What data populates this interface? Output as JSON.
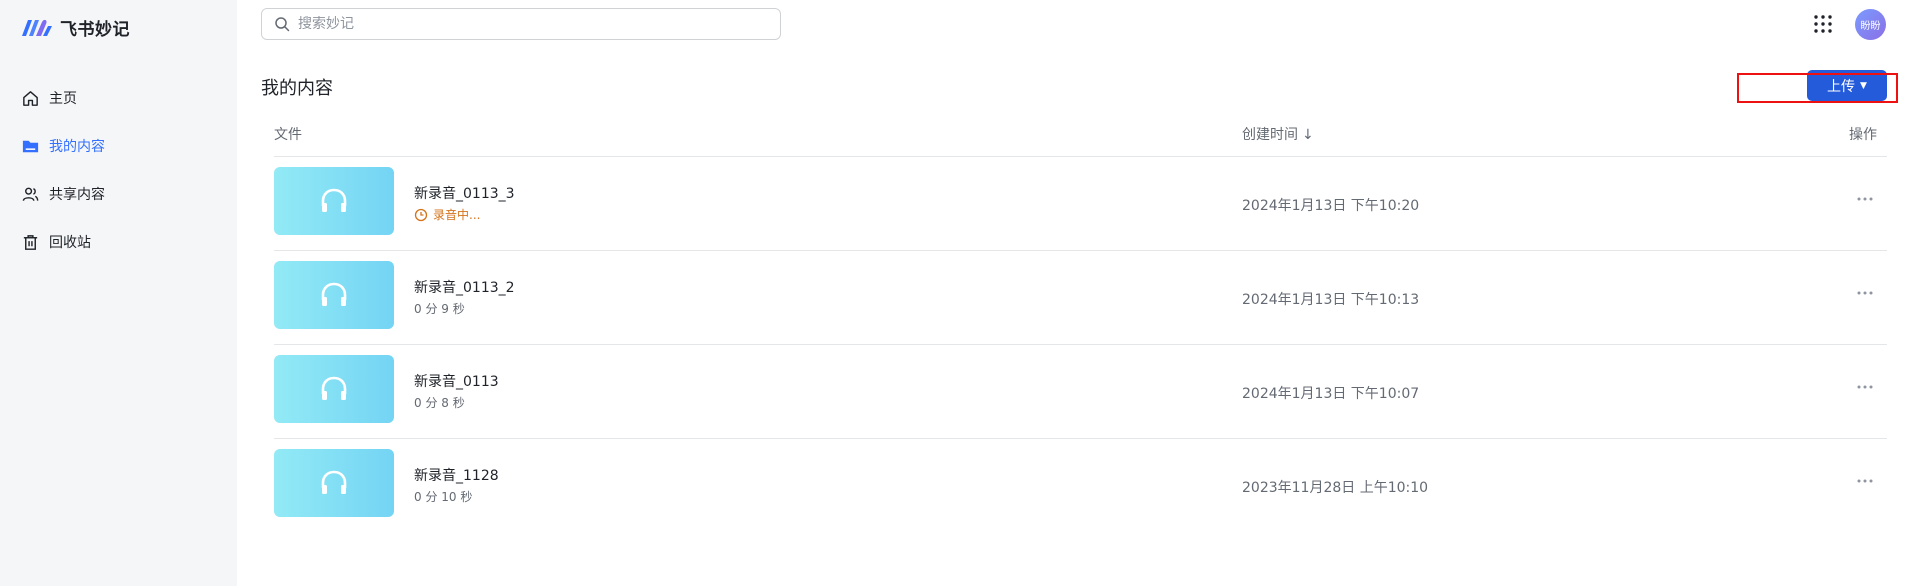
{
  "app": {
    "name": "飞书妙记",
    "colors": {
      "accent": "#3370ff",
      "button": "#245bdb",
      "sidebar_bg": "#f5f6f7",
      "recording": "#d4731b"
    }
  },
  "sidebar": {
    "items": [
      {
        "label": "主页",
        "icon": "home-icon",
        "active": false
      },
      {
        "label": "我的内容",
        "icon": "folder-icon",
        "active": true
      },
      {
        "label": "共享内容",
        "icon": "users-icon",
        "active": false
      },
      {
        "label": "回收站",
        "icon": "trash-icon",
        "active": false
      }
    ]
  },
  "header": {
    "search_placeholder": "搜索妙记",
    "avatar_text": "盼盼"
  },
  "main": {
    "title": "我的内容",
    "upload_label": "上传",
    "columns": {
      "file": "文件",
      "created": "创建时间",
      "sort_arrow": "↓",
      "actions": "操作"
    },
    "rows": [
      {
        "name": "新录音_0113_3",
        "sub": "录音中...",
        "status": "recording",
        "created": "2024年1月13日 下午10:20"
      },
      {
        "name": "新录音_0113_2",
        "sub": "0 分 9 秒",
        "status": "done",
        "created": "2024年1月13日 下午10:13"
      },
      {
        "name": "新录音_0113",
        "sub": "0 分 8 秒",
        "status": "done",
        "created": "2024年1月13日 下午10:07"
      },
      {
        "name": "新录音_1128",
        "sub": "0 分 10 秒",
        "status": "done",
        "created": "2023年11月28日 上午10:10"
      }
    ]
  }
}
